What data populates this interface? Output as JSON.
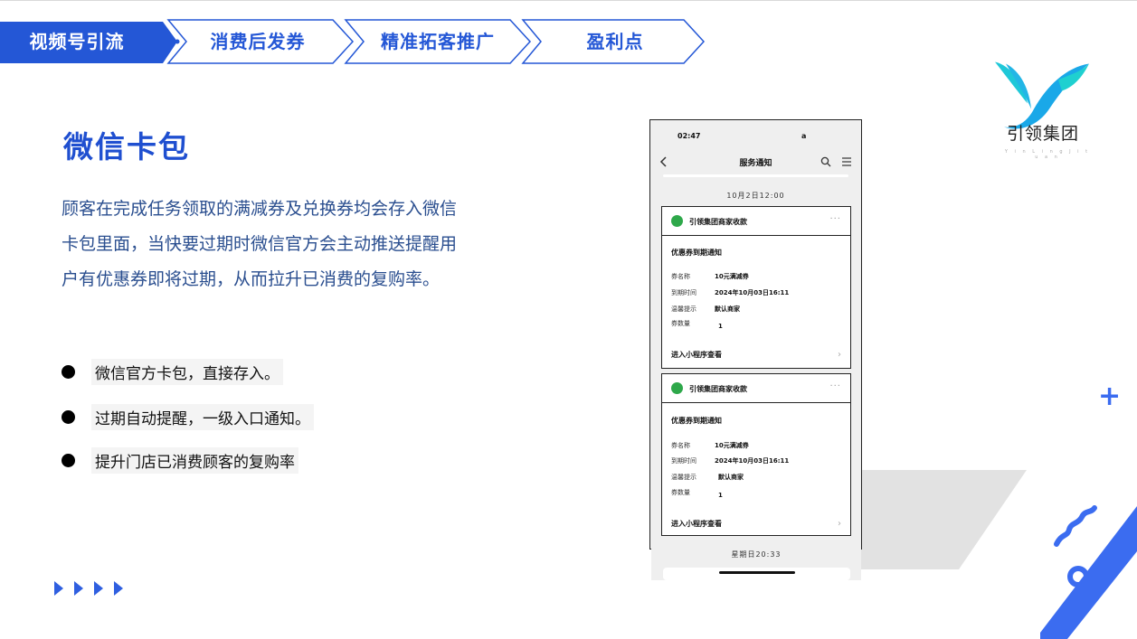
{
  "nav": {
    "items": [
      {
        "label": "视频号引流",
        "active": true
      },
      {
        "label": "消费后发券",
        "active": false
      },
      {
        "label": "精准拓客推广",
        "active": false
      },
      {
        "label": "盈利点",
        "active": false
      }
    ]
  },
  "logo": {
    "name": "引领集团",
    "sub": "Y i n  L i n g  J i t u a n"
  },
  "main": {
    "title": "微信卡包",
    "paragraph": "顾客在完成任务领取的满减券及兑换券均会存入微信卡包里面，当快要过期时微信官方会主动推送提醒用户有优惠券即将过期，从而拉升已消费的复购率。",
    "bullets": [
      "微信官方卡包，直接存入。",
      "过期自动提醒，一级入口通知。",
      "提升门店已消费顾客的复购率"
    ]
  },
  "phone": {
    "time": "02:47",
    "signal": "a",
    "header_title": "服务通知",
    "date_top": "10月2日12:00",
    "date_bottom": "星期日20:33",
    "cards": [
      {
        "sender": "引领集团商家收款",
        "more": "···",
        "notice_title": "优惠券到期通知",
        "rows": [
          {
            "key": "券名称",
            "value": "10元满减券"
          },
          {
            "key": "到期时间",
            "value": "2024年10月03日16:11"
          },
          {
            "key": "温馨提示",
            "value": "默认商家"
          },
          {
            "key": "券数量",
            "value": "1"
          }
        ],
        "link": "进入小程序查看",
        "arrow": "›"
      },
      {
        "sender": "引领集团商家收款",
        "more": "···",
        "notice_title": "优惠券到期通知",
        "rows": [
          {
            "key": "券名称",
            "value": "10元满减券"
          },
          {
            "key": "到期时间",
            "value": "2024年10月03日16:11"
          },
          {
            "key": "温馨提示",
            "value": "默认商家"
          },
          {
            "key": "券数量",
            "value": "1"
          }
        ],
        "link": "进入小程序查看",
        "arrow": "›"
      }
    ]
  },
  "decor": {
    "plus": "+"
  },
  "colors": {
    "accent": "#2457d6",
    "accent_light": "#3b6cf0",
    "teal": "#1fc8d8"
  }
}
